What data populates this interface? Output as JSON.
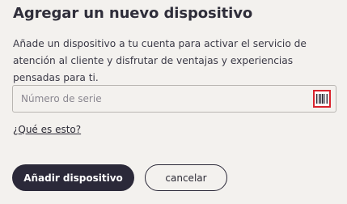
{
  "dialog": {
    "title": "Agregar un nuevo dispositivo",
    "description": "Añade un dispositivo a tu cuenta para activar el servicio de atención al cliente y disfrutar de ventajas y experiencias pensadas para ti.",
    "serial_field": {
      "placeholder": "Número de serie",
      "value": "",
      "scan_icon": "barcode-scan-icon"
    },
    "help_link": "¿Qué es esto?",
    "add_button": "Añadir dispositivo",
    "cancel_button": "cancelar"
  },
  "colors": {
    "background": "#f3f1ee",
    "primary": "#2b2939",
    "highlight": "#d9232d"
  }
}
